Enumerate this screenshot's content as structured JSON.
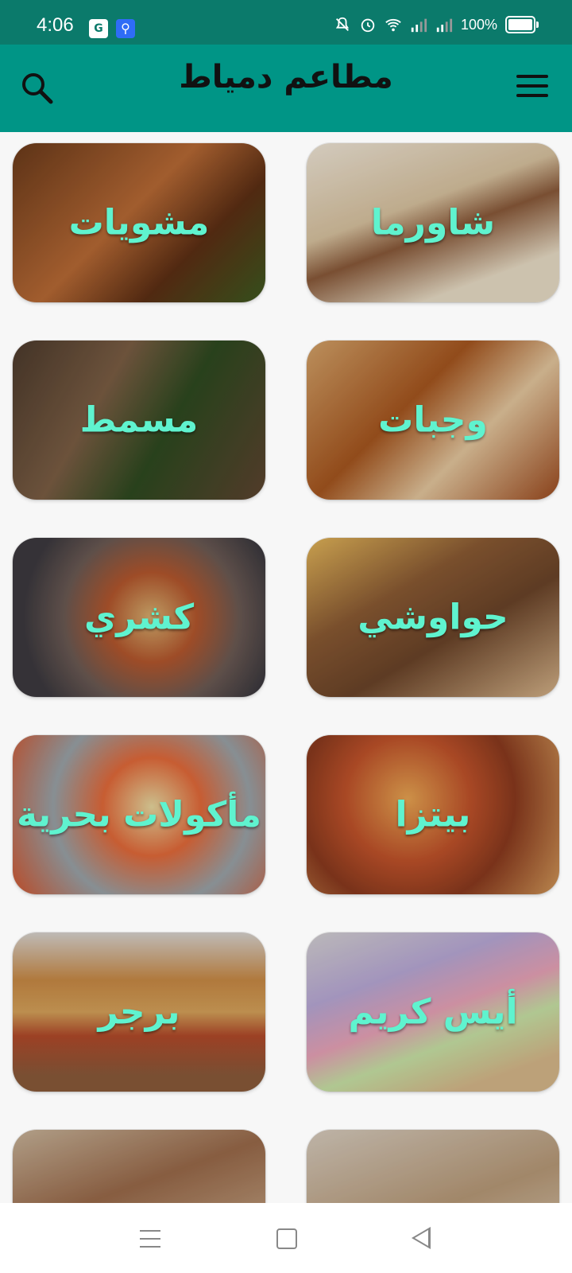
{
  "status_bar": {
    "time": "4:06",
    "battery_percent": "100%",
    "battery_level": 1.0,
    "icons": [
      "translate-icon",
      "usb-icon",
      "mute-icon",
      "alarm-icon",
      "wifi-icon",
      "signal-icon",
      "signal-icon"
    ]
  },
  "app_bar": {
    "title": "مطاعم دمياط",
    "search_icon": "search-icon",
    "menu_icon": "menu-icon",
    "color": "#009586"
  },
  "categories": [
    {
      "label": "مشويات",
      "bg": "#8b4a25"
    },
    {
      "label": "شاورما",
      "bg": "#d8c8ad"
    },
    {
      "label": "مسمط",
      "bg": "#5a4a3a"
    },
    {
      "label": "وجبات",
      "bg": "#b97a45"
    },
    {
      "label": "كشري",
      "bg": "#8a6a5a"
    },
    {
      "label": "حواوشي",
      "bg": "#a9794b"
    },
    {
      "label": "مأكولات بحرية",
      "bg": "#c96b4a"
    },
    {
      "label": "بيتزا",
      "bg": "#b8553a"
    },
    {
      "label": "برجر",
      "bg": "#c9a070"
    },
    {
      "label": "أيس كريم",
      "bg": "#cfcaca"
    },
    {
      "label": "",
      "bg": "#a88a6a"
    },
    {
      "label": "",
      "bg": "#c9b49a"
    }
  ],
  "label_color": "#5ff3cf",
  "nav_bar": {
    "icons": [
      "menu-icon",
      "home-icon",
      "back-icon"
    ]
  }
}
